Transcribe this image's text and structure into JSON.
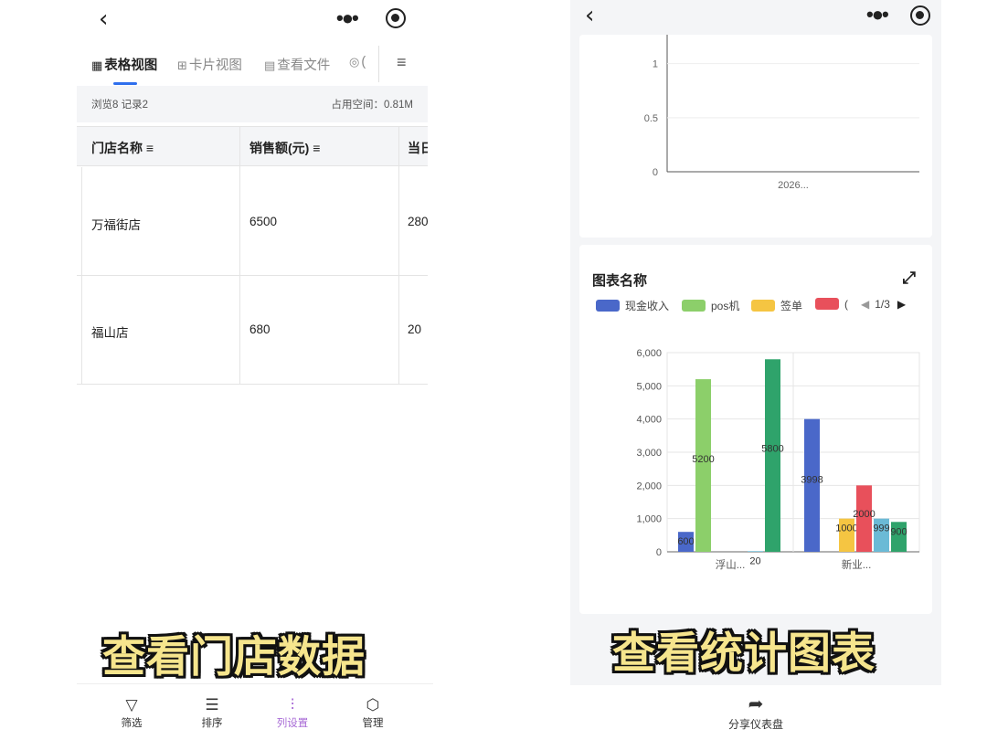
{
  "left": {
    "nav": {
      "back_icon": "chevron-left-icon",
      "more_icon": "more-dots-icon",
      "target_icon": "target-icon"
    },
    "tabs": [
      {
        "icon": "▦",
        "label": "表格视图"
      },
      {
        "icon": "⊞",
        "label": "卡片视图"
      },
      {
        "icon": "▤",
        "label": "查看文件"
      },
      {
        "icon": "◎",
        "label": "("
      }
    ],
    "menu_icon": "≡",
    "stats": {
      "left": "浏览8  记录2",
      "right": "占用空间：0.81M"
    },
    "table": {
      "headers": [
        "门店名称 ≡",
        "销售额(元) ≡",
        "当日"
      ],
      "rows": [
        [
          "万福街店",
          "6500",
          "280"
        ],
        [
          "福山店",
          "680",
          "20"
        ]
      ]
    },
    "caption": "查看门店数据",
    "bottom_nav": [
      {
        "icon": "▽",
        "label": "筛选"
      },
      {
        "icon": "☰",
        "label": "排序"
      },
      {
        "icon": "⫶",
        "label": "列设置"
      },
      {
        "icon": "⬡",
        "label": "管理"
      }
    ]
  },
  "right": {
    "caption": "查看统计图表",
    "share_label": "分享仪表盘",
    "chart_title": "图表名称",
    "legend_pager": "1/3",
    "colors": {
      "cash": "#4a68c9",
      "pos": "#8ccf6a",
      "sign": "#f5c542",
      "red": "#e8505b",
      "lightblue": "#6bbad6",
      "green": "#2fa36b"
    }
  },
  "chart_data": [
    {
      "type": "line",
      "x": [
        "2026..."
      ],
      "y_ticks": [
        "0",
        "0.5",
        "1"
      ],
      "ylim": [
        0,
        1.2
      ],
      "series": []
    },
    {
      "type": "bar",
      "title": "图表名称",
      "categories": [
        "浮山...",
        "新业..."
      ],
      "y_ticks": [
        "0",
        "1,000",
        "2,000",
        "3,000",
        "4,000",
        "5,000",
        "6,000"
      ],
      "ylim": [
        0,
        6000
      ],
      "legend": [
        "现金收入",
        "pos机",
        "签单",
        "("
      ],
      "series": [
        {
          "name": "现金收入",
          "color": "#4a68c9",
          "values": [
            600,
            4000
          ],
          "labels": [
            "600",
            "3998"
          ]
        },
        {
          "name": "pos机",
          "color": "#8ccf6a",
          "values": [
            5200,
            0
          ],
          "labels": [
            "5200",
            ""
          ]
        },
        {
          "color": "#f5c542",
          "values": [
            0,
            1000
          ],
          "labels": [
            "",
            "1000"
          ]
        },
        {
          "color": "#e8505b",
          "values": [
            0,
            2000
          ],
          "labels": [
            "",
            "2000"
          ]
        },
        {
          "color": "#6bbad6",
          "values": [
            20,
            1000
          ],
          "labels": [
            "20",
            "999"
          ]
        },
        {
          "color": "#2fa36b",
          "values": [
            5800,
            900
          ],
          "labels": [
            "5800",
            "900"
          ]
        }
      ],
      "grid": true,
      "legend_position": "top"
    }
  ]
}
